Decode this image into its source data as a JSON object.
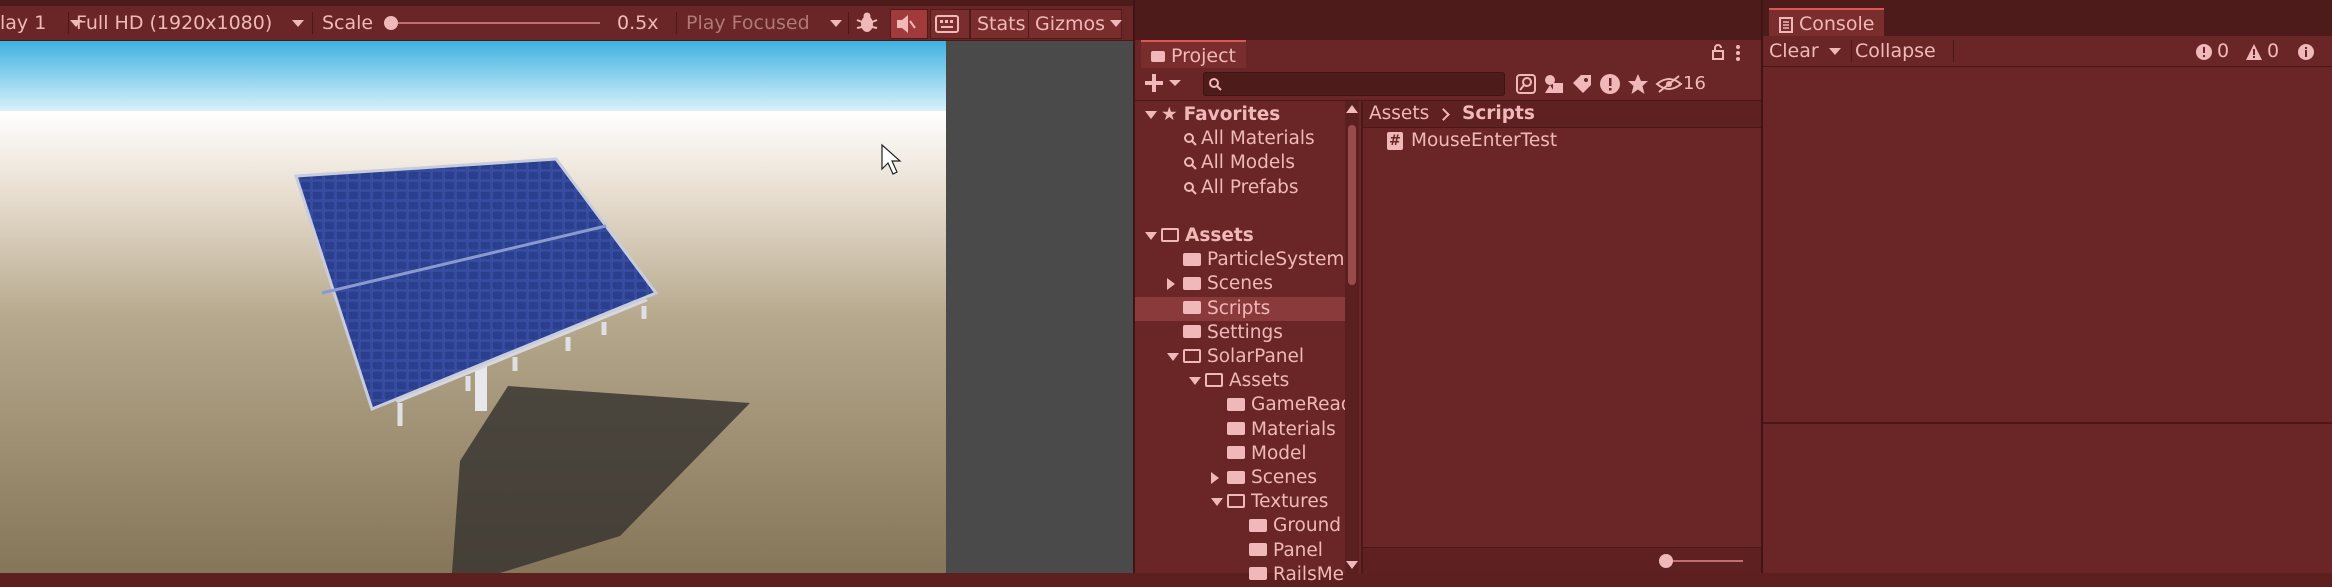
{
  "game": {
    "display_label": "lay 1",
    "resolution": "Full HD (1920x1080)",
    "scale_label": "Scale",
    "scale_value": "0.5x",
    "play_mode": "Play Focused",
    "stats_label": "Stats",
    "gizmos_label": "Gizmos"
  },
  "project": {
    "tab_label": "Project",
    "search_placeholder": "",
    "hidden_count": "16",
    "breadcrumb": [
      "Assets",
      "Scripts"
    ],
    "tree": [
      {
        "label": "Favorites",
        "indent": 0,
        "expanded": true,
        "icon": "star-icon",
        "bold": true
      },
      {
        "label": "All Materials",
        "indent": 1,
        "icon": "search-icon"
      },
      {
        "label": "All Models",
        "indent": 1,
        "icon": "search-icon"
      },
      {
        "label": "All Prefabs",
        "indent": 1,
        "icon": "search-icon"
      },
      {
        "label": "",
        "indent": 0,
        "spacer": true
      },
      {
        "label": "Assets",
        "indent": 0,
        "expanded": true,
        "icon": "folder-open-icon",
        "bold": true
      },
      {
        "label": "ParticleSystems",
        "indent": 1,
        "icon": "folder-icon"
      },
      {
        "label": "Scenes",
        "indent": 1,
        "collapsed": true,
        "icon": "folder-icon"
      },
      {
        "label": "Scripts",
        "indent": 1,
        "icon": "folder-icon",
        "selected": true
      },
      {
        "label": "Settings",
        "indent": 1,
        "icon": "folder-icon"
      },
      {
        "label": "SolarPanel",
        "indent": 1,
        "expanded": true,
        "icon": "folder-open-icon"
      },
      {
        "label": "Assets",
        "indent": 2,
        "expanded": true,
        "icon": "folder-open-icon"
      },
      {
        "label": "GameReady",
        "indent": 3,
        "icon": "folder-icon"
      },
      {
        "label": "Materials",
        "indent": 3,
        "icon": "folder-icon"
      },
      {
        "label": "Model",
        "indent": 3,
        "icon": "folder-icon"
      },
      {
        "label": "Scenes",
        "indent": 3,
        "collapsed": true,
        "icon": "folder-icon"
      },
      {
        "label": "Textures",
        "indent": 3,
        "expanded": true,
        "icon": "folder-open-icon"
      },
      {
        "label": "Ground",
        "indent": 4,
        "icon": "folder-icon"
      },
      {
        "label": "Panel",
        "indent": 4,
        "icon": "folder-icon"
      },
      {
        "label": "RailsMe",
        "indent": 4,
        "icon": "folder-icon"
      }
    ],
    "files": [
      {
        "label": "MouseEnterTest",
        "icon": "csharp-script-icon"
      }
    ],
    "zoom_level": 0.0
  },
  "console": {
    "tab_label": "Console",
    "clear_label": "Clear",
    "collapse_label": "Collapse",
    "error_count": "0",
    "warning_count": "0"
  },
  "colors": {
    "play_tint": "#6a2626",
    "accent": "#e05555",
    "text": "#f0b8b8",
    "panel_blue": "#2b3f8f"
  }
}
